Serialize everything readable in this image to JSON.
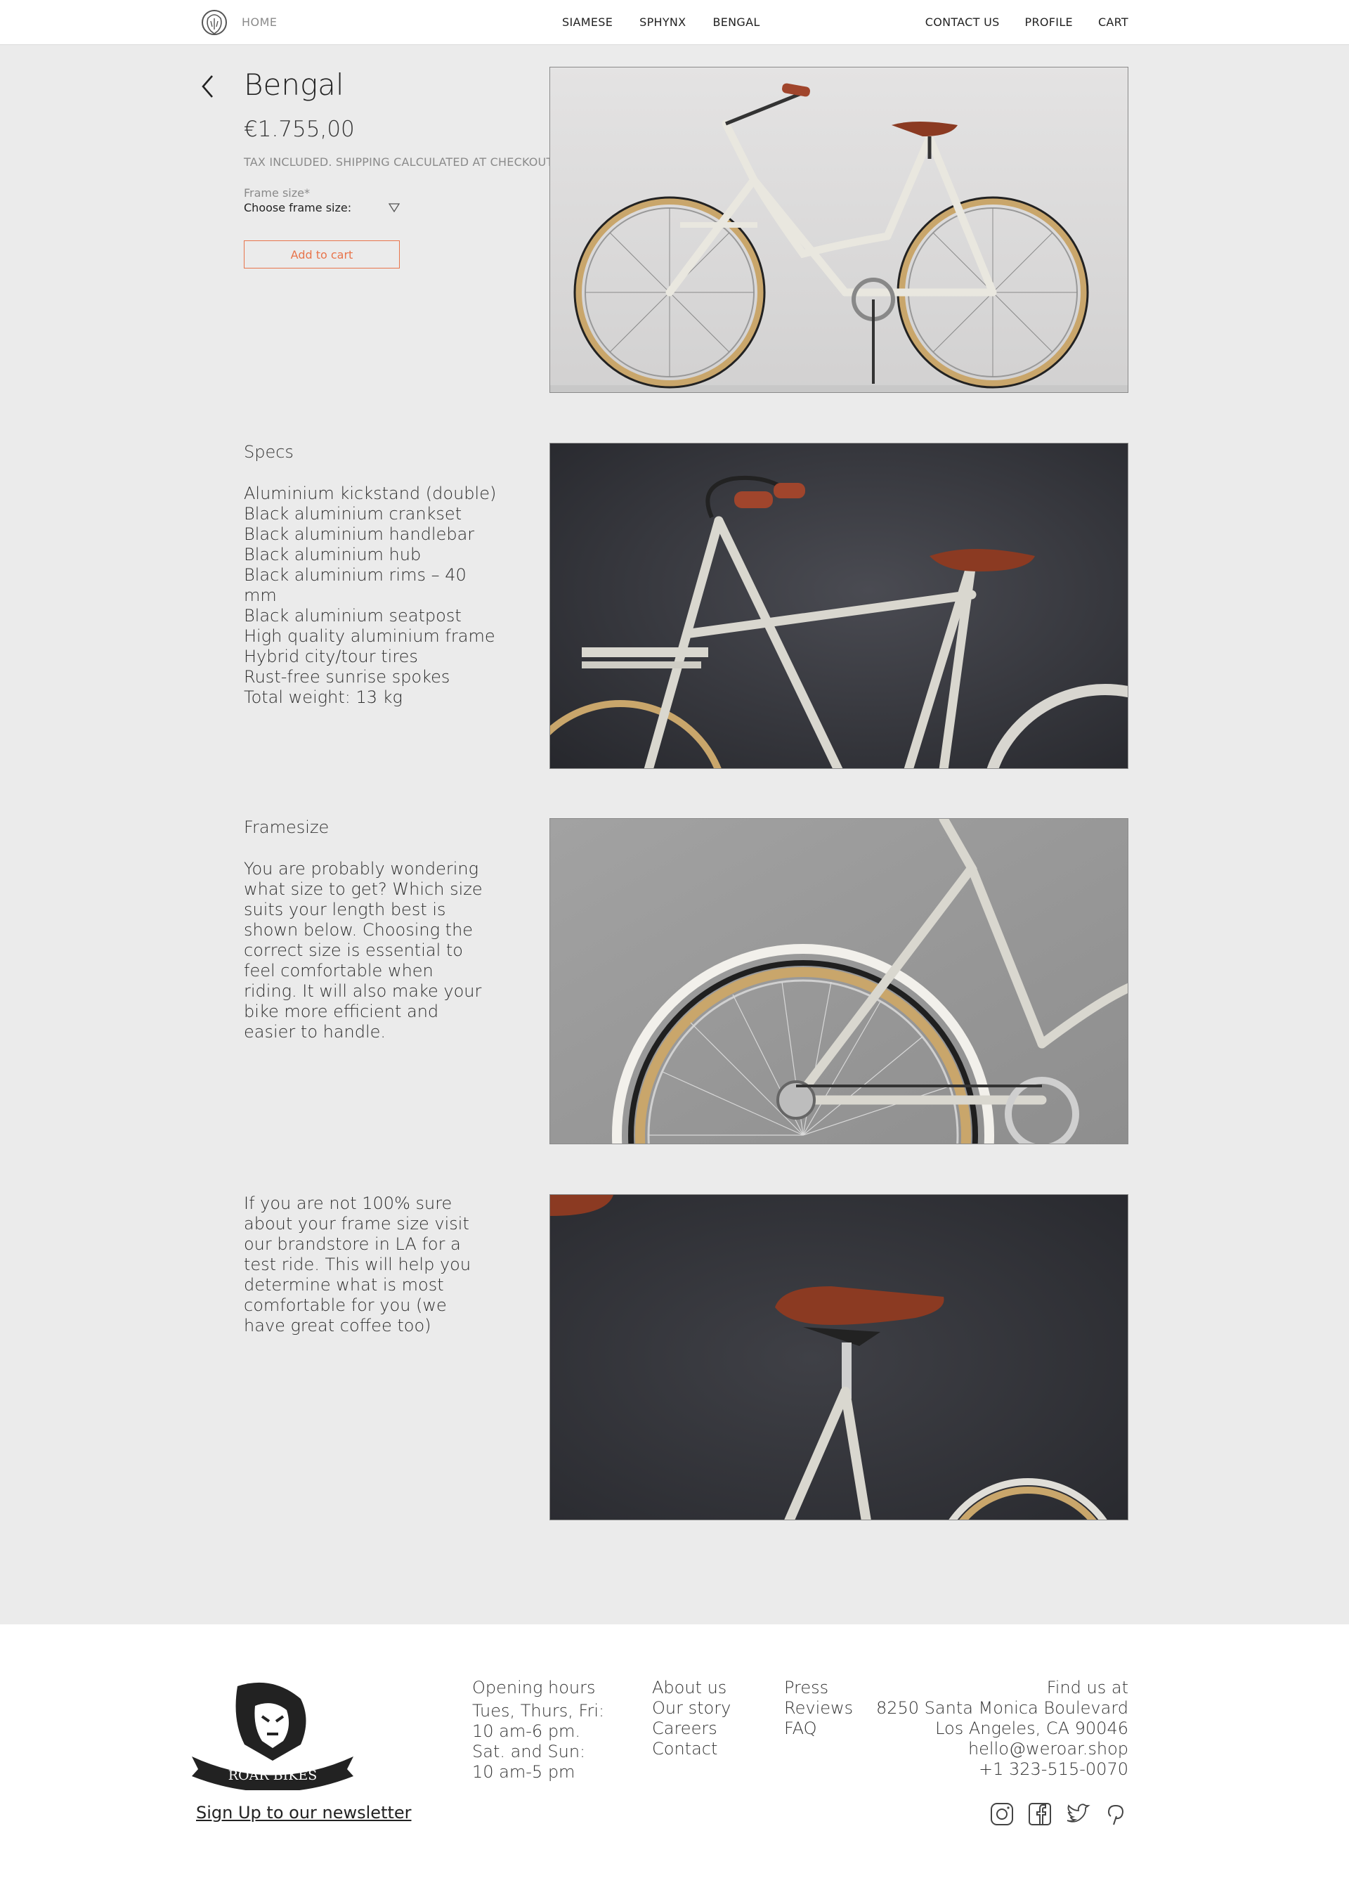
{
  "nav": {
    "home": "HOME",
    "center_links": [
      "SIAMESE",
      "SPHYNX",
      "BENGAL"
    ],
    "right_links": [
      "CONTACT US",
      "PROFILE",
      "CART"
    ]
  },
  "product": {
    "title": "Bengal",
    "price": "€1.755,00",
    "tax_note": "TAX INCLUDED. SHIPPING CALCULATED AT CHECKOUT.",
    "frame_label": "Frame size*",
    "frame_select": "Choose frame size:",
    "add_to_cart": "Add to cart"
  },
  "specs": {
    "heading": "Specs",
    "items": [
      "Aluminium kickstand (double)",
      "Black aluminium crankset",
      "Black aluminium handlebar",
      "Black aluminium hub",
      "Black aluminium rims – 40 mm",
      "Black aluminium seatpost",
      "High quality aluminium frame",
      "Hybrid city/tour tires",
      "Rust-free sunrise spokes",
      "Total weight: 13 kg"
    ]
  },
  "framesize": {
    "heading": "Framesize",
    "body": "You are probably wondering what size to get? Which size suits your length best is shown below. Choosing the correct size is essential to feel comfortable when riding. It will also make your bike more efficient and easier to handle."
  },
  "store_note": {
    "body": "If you are not 100% sure about your frame size visit our brandstore in LA for a test ride. This will help you determine what is most comfortable for you (we have great coffee too)"
  },
  "footer": {
    "logo_text": "ROAR BIKES",
    "newsletter": "Sign Up to our newsletter",
    "hours_heading": "Opening hours",
    "hours_lines": [
      "Tues, Thurs, Fri:",
      "10 am-6 pm.",
      "Sat. and Sun:",
      "10 am-5 pm"
    ],
    "col2": [
      "About us",
      "Our story",
      "Careers",
      "Contact"
    ],
    "col3": [
      "Press",
      "Reviews",
      "FAQ"
    ],
    "find_heading": "Find us at",
    "find_lines": [
      "8250 Santa Monica Boulevard",
      "Los Angeles, CA 90046",
      "hello@weroar.shop",
      "+1 323-515-0070"
    ],
    "social_icons": [
      "instagram-icon",
      "facebook-icon",
      "twitter-icon",
      "pinterest-icon"
    ]
  },
  "colors": {
    "accent": "#e8744b",
    "page_bg": "#ebebeb",
    "saddle": "#8b3a22"
  }
}
